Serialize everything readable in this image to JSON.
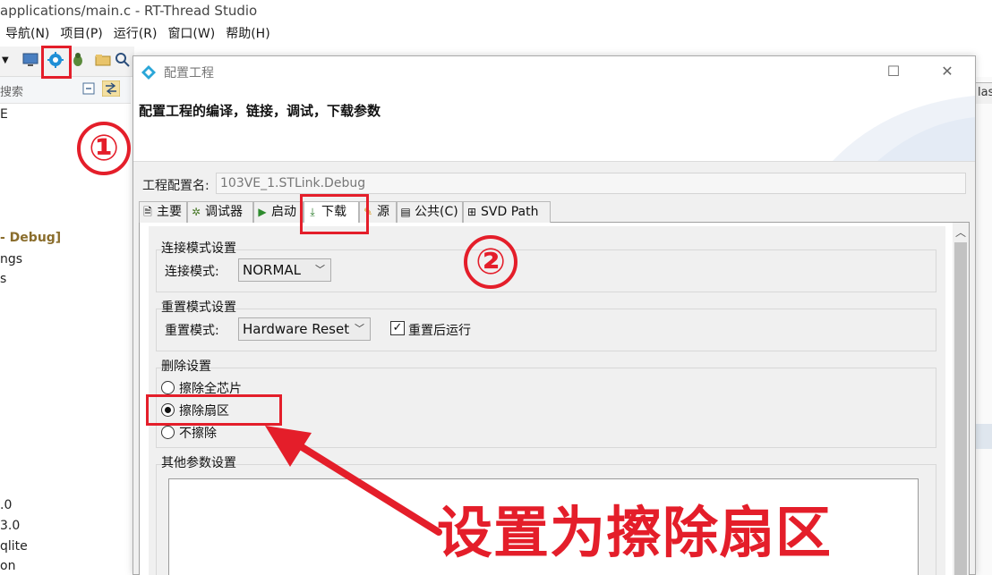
{
  "ide": {
    "window_title": "applications/main.c - RT-Thread Studio",
    "menus": [
      "导航(N)",
      "项目(P)",
      "运行(R)",
      "窗口(W)",
      "帮助(H)"
    ],
    "search_label": "搜索",
    "tree_items": [
      "E",
      "- Debug]",
      "ngs",
      "s",
      ".0",
      "3.0",
      "qlite",
      "on"
    ],
    "right_tab_text": "lasl"
  },
  "dialog": {
    "title": "配置工程",
    "description": "配置工程的编译，链接，调试，下载参数",
    "config_name_label": "工程配置名:",
    "config_name_value": "103VE_1.STLink.Debug",
    "tabs": [
      {
        "label": "主要",
        "icon": "document-icon"
      },
      {
        "label": "调试器",
        "icon": "bug-gear-icon"
      },
      {
        "label": "启动",
        "icon": "play-icon"
      },
      {
        "label": "下载",
        "icon": "download-arrow-icon"
      },
      {
        "label": "源",
        "icon": "pencil-icon"
      },
      {
        "label": "公共(C)",
        "icon": "table-icon"
      },
      {
        "label": "SVD Path",
        "icon": "tree-icon"
      }
    ],
    "active_tab": "下载",
    "connect_group": {
      "title": "连接模式设置",
      "label": "连接模式:",
      "value": "NORMAL"
    },
    "reset_group": {
      "title": "重置模式设置",
      "label": "重置模式:",
      "value": "Hardware Reset",
      "run_after_reset_label": "重置后运行",
      "run_after_reset_checked": true
    },
    "erase_group": {
      "title": "删除设置",
      "options": [
        "擦除全芯片",
        "擦除扇区",
        "不擦除"
      ],
      "selected": "擦除扇区"
    },
    "other_group": {
      "title": "其他参数设置",
      "value": ""
    }
  },
  "annotations": {
    "marker_1": "①",
    "marker_2": "②",
    "note": "设置为擦除扇区",
    "color": "#e41e2a"
  }
}
